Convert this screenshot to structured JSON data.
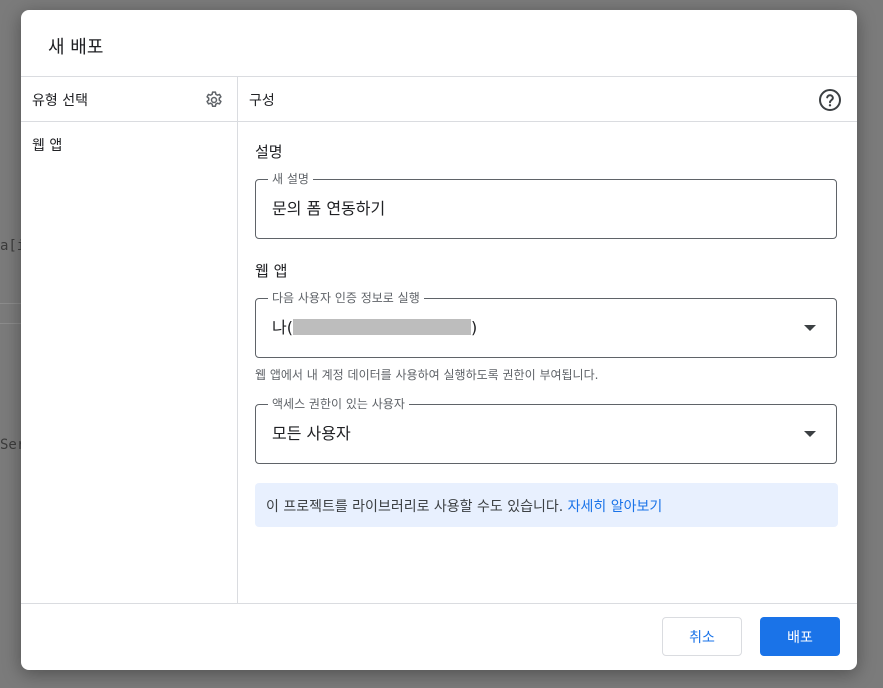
{
  "background": {
    "fragment_a": "a[i",
    "fragment_b": "Ser"
  },
  "dialog": {
    "title": "새 배포",
    "left_column": {
      "header": "유형 선택",
      "settings_icon": "gear-icon",
      "items": [
        {
          "label": "웹 앱"
        }
      ]
    },
    "right_column": {
      "header": "구성",
      "help_icon": "help-circle-icon",
      "description_section": {
        "title": "설명",
        "field_label": "새 설명",
        "field_value": "문의 폼 연동하기"
      },
      "webapp_section": {
        "title": "웹 앱",
        "execute_as": {
          "label": "다음 사용자 인증 정보로 실행",
          "value_prefix": "나(",
          "value_suffix": ")"
        },
        "helper_text": "웹 앱에서 내 계정 데이터를 사용하여 실행하도록 권한이 부여됩니다.",
        "access": {
          "label": "액세스 권한이 있는 사용자",
          "value": "모든 사용자"
        }
      },
      "info": {
        "text": "이 프로젝트를 라이브러리로 사용할 수도 있습니다.",
        "link": "자세히 알아보기"
      }
    },
    "footer": {
      "cancel_label": "취소",
      "deploy_label": "배포"
    },
    "colors": {
      "accent": "#1a73e8",
      "info_bg": "#e8f0fe",
      "divider": "#dadce0"
    }
  }
}
